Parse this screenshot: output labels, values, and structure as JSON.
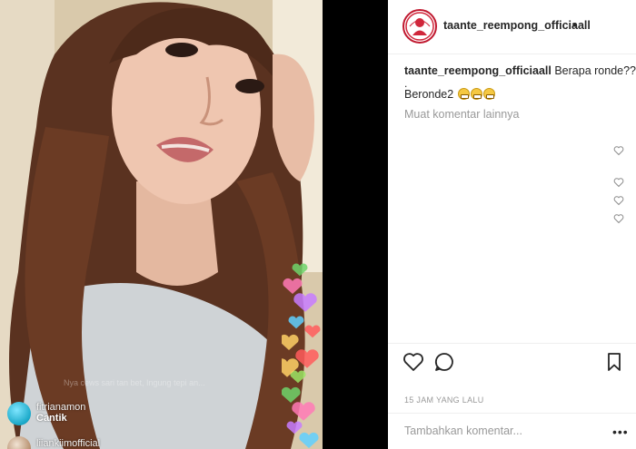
{
  "post": {
    "username": "taante_reempong_officiaall",
    "header_dot": "•",
    "caption_text": "Berapa ronde??",
    "caption_dot": ".",
    "reply_text": "Beronde2",
    "reply_emoji": [
      "grinning-face-emoji",
      "grinning-face-emoji",
      "grinning-face-emoji"
    ],
    "more_comments": "Muat komentar lainnya",
    "timestamp": "15 JAM YANG LALU",
    "comment_placeholder": "Tambahkan komentar...",
    "options": "•••"
  },
  "video": {
    "watermark": "Nya cews sari tan bet, Ingung tepi an...",
    "live_comments": [
      {
        "user": "fitrianamon",
        "message": "Cantik"
      },
      {
        "user": "liiankiimofficial",
        "message": ""
      }
    ],
    "heart_colors": [
      "#6fd36a",
      "#ff7ab6",
      "#c77dff",
      "#5fd0ff",
      "#ffd166",
      "#ff5c5c",
      "#9be564"
    ]
  },
  "icons": {
    "header": "profile-logo-icon",
    "actions": [
      "heart-outline-icon",
      "comment-bubble-icon",
      "bookmark-icon"
    ],
    "comment_like": "heart-small-icon"
  }
}
